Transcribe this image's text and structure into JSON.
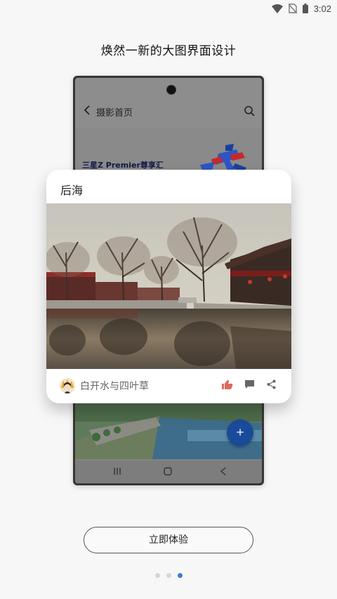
{
  "status_bar": {
    "time": "3:02"
  },
  "headline": "焕然一新的大图界面设计",
  "mock_screen": {
    "title": "摄影首页",
    "banner_text": "三星Z Premier尊享汇"
  },
  "card": {
    "title": "后海",
    "author": "白开水与四叶草"
  },
  "fab_label": "+",
  "cta_label": "立即体验",
  "pager": {
    "total": 3,
    "active": 3
  },
  "colors": {
    "accent": "#3a7de0",
    "fab": "#1a4a9a",
    "like": "#e0685a"
  }
}
